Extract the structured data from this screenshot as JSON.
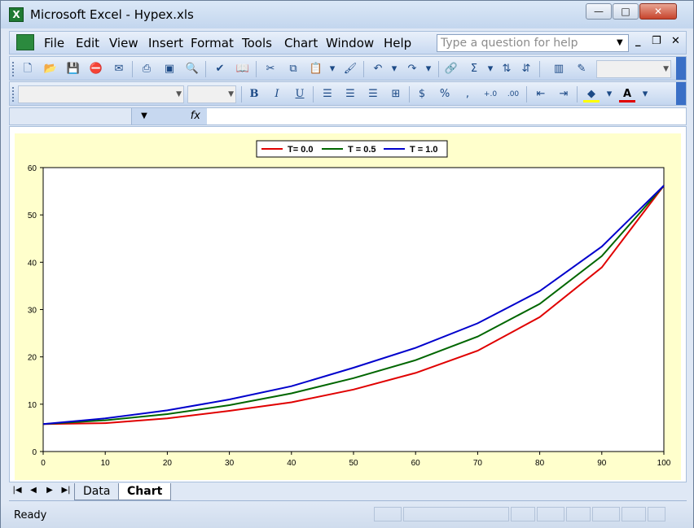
{
  "window": {
    "title": "Microsoft Excel - Hypex.xls",
    "app_letter": "X"
  },
  "controls": {
    "min": "—",
    "max": "□",
    "close": "✕"
  },
  "menu": {
    "items": [
      "File",
      "Edit",
      "View",
      "Insert",
      "Format",
      "Tools",
      "Chart",
      "Window",
      "Help"
    ],
    "help_placeholder": "Type a question for help"
  },
  "formula": {
    "fx": "fx",
    "namebox": ""
  },
  "sheets": {
    "tabs": [
      "Data",
      "Chart"
    ],
    "active": "Chart"
  },
  "status": {
    "text": "Ready"
  },
  "colors": {
    "chart_bg": "#ffffcc",
    "red": "#e00000",
    "green": "#006600",
    "blue": "#0000cc"
  },
  "chart_data": {
    "type": "line",
    "title": "",
    "xlabel": "",
    "ylabel": "",
    "xlim": [
      0,
      100
    ],
    "ylim": [
      0,
      60
    ],
    "xticks": [
      0,
      10,
      20,
      30,
      40,
      50,
      60,
      70,
      80,
      90,
      100
    ],
    "yticks": [
      0,
      10,
      20,
      30,
      40,
      50,
      60
    ],
    "legend_position": "top-center",
    "grid": false,
    "x": [
      0,
      10,
      20,
      30,
      40,
      50,
      60,
      70,
      80,
      90,
      100
    ],
    "series": [
      {
        "name": "T= 0.0",
        "color": "#e00000",
        "values": [
          5.8,
          6.0,
          7.0,
          8.6,
          10.4,
          13.1,
          16.6,
          21.3,
          28.4,
          38.9,
          56.2
        ]
      },
      {
        "name": "T = 0.5",
        "color": "#006600",
        "values": [
          5.8,
          6.6,
          7.9,
          9.8,
          12.3,
          15.5,
          19.3,
          24.3,
          31.2,
          41.3,
          56.2
        ]
      },
      {
        "name": "T = 1.0",
        "color": "#0000cc",
        "values": [
          5.8,
          7.0,
          8.7,
          11.0,
          13.8,
          17.7,
          21.9,
          27.1,
          33.9,
          43.3,
          56.2
        ]
      }
    ]
  }
}
